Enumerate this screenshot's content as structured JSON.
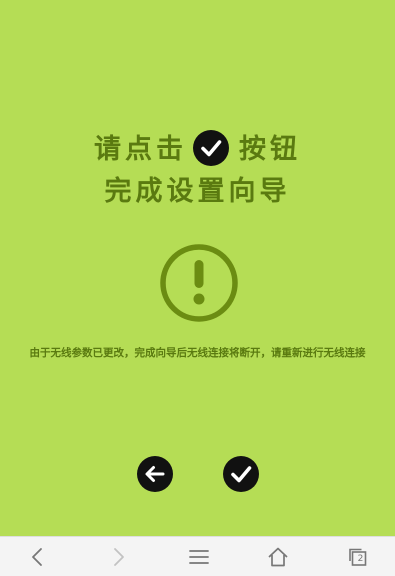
{
  "prompt": {
    "line1_before": "请点击",
    "line1_after": "按钮",
    "line2": "完成设置向导"
  },
  "notice": "由于无线参数已更改，完成向导后无线连接将断开，请重新进行无线连接",
  "icons": {
    "inline_check": "check-circle-icon",
    "warning": "exclamation-circle-icon",
    "back": "back-arrow-icon",
    "finish": "check-icon"
  },
  "browser_nav": {
    "tab_count": "2"
  },
  "colors": {
    "background": "#b5dd55",
    "text": "#5a7a10",
    "button": "#111111",
    "navbar": "#f4f4f4"
  }
}
